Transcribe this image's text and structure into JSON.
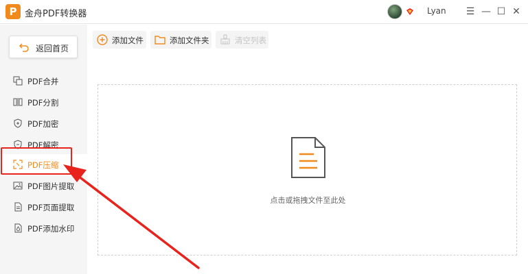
{
  "window": {
    "logo_letter": "P",
    "title": "金舟PDF转换器",
    "user": {
      "name": "Lyan"
    },
    "controls": {
      "menu": "☰",
      "minimize": "—",
      "maximize": "☐",
      "close": "✕"
    }
  },
  "sidebar": {
    "home_label": "返回首页",
    "items": [
      {
        "label": "PDF合并",
        "icon": "merge-icon"
      },
      {
        "label": "PDF分割",
        "icon": "split-icon"
      },
      {
        "label": "PDF加密",
        "icon": "shield-plus-icon"
      },
      {
        "label": "PDF解密",
        "icon": "shield-minus-icon"
      },
      {
        "label": "PDF压缩",
        "icon": "compress-icon",
        "active": true
      },
      {
        "label": "PDF图片提取",
        "icon": "image-icon"
      },
      {
        "label": "PDF页面提取",
        "icon": "page-icon"
      },
      {
        "label": "PDF添加水印",
        "icon": "watermark-icon"
      }
    ]
  },
  "toolbar": {
    "add_file": "添加文件",
    "add_folder": "添加文件夹",
    "clear_list": "清空列表"
  },
  "dropzone": {
    "hint": "点击或拖拽文件至此处"
  },
  "colors": {
    "accent": "#f08a1c",
    "annotation": "#e8231c"
  }
}
